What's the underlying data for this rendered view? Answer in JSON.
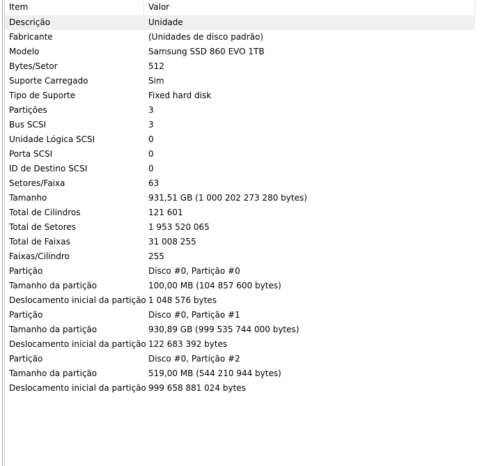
{
  "columns": {
    "item": "Item",
    "value": "Valor"
  },
  "rows": [
    {
      "item": "Descrição",
      "value": "Unidade"
    },
    {
      "item": "Fabricante",
      "value": "(Unidades de disco padrão)"
    },
    {
      "item": "Modelo",
      "value": "Samsung SSD 860 EVO 1TB"
    },
    {
      "item": "Bytes/Setor",
      "value": "512"
    },
    {
      "item": "Suporte Carregado",
      "value": "Sim"
    },
    {
      "item": "Tipo de Suporte",
      "value": "Fixed hard disk"
    },
    {
      "item": "Partições",
      "value": "3"
    },
    {
      "item": "Bus SCSI",
      "value": "3"
    },
    {
      "item": "Unidade Lógica SCSI",
      "value": "0"
    },
    {
      "item": "Porta SCSI",
      "value": "0"
    },
    {
      "item": "ID de Destino SCSI",
      "value": "0"
    },
    {
      "item": "Setores/Faixa",
      "value": "63"
    },
    {
      "item": "Tamanho",
      "value": "931,51 GB (1 000 202 273 280 bytes)"
    },
    {
      "item": "Total de Cilindros",
      "value": "121 601"
    },
    {
      "item": "Total de Setores",
      "value": "1 953 520 065"
    },
    {
      "item": "Total de Faixas",
      "value": "31 008 255"
    },
    {
      "item": "Faixas/Cilindro",
      "value": "255"
    },
    {
      "item": "Partição",
      "value": "Disco #0, Partição #0"
    },
    {
      "item": "Tamanho da partição",
      "value": "100,00 MB (104 857 600 bytes)"
    },
    {
      "item": "Deslocamento inicial da partição",
      "value": "1 048 576 bytes"
    },
    {
      "item": "Partição",
      "value": "Disco #0, Partição #1"
    },
    {
      "item": "Tamanho da partição",
      "value": "930,89 GB (999 535 744 000 bytes)"
    },
    {
      "item": "Deslocamento inicial da partição",
      "value": "122 683 392 bytes"
    },
    {
      "item": "Partição",
      "value": "Disco #0, Partição #2"
    },
    {
      "item": "Tamanho da partição",
      "value": "519,00 MB (544 210 944 bytes)"
    },
    {
      "item": "Deslocamento inicial da partição",
      "value": "999 658 881 024 bytes"
    }
  ]
}
